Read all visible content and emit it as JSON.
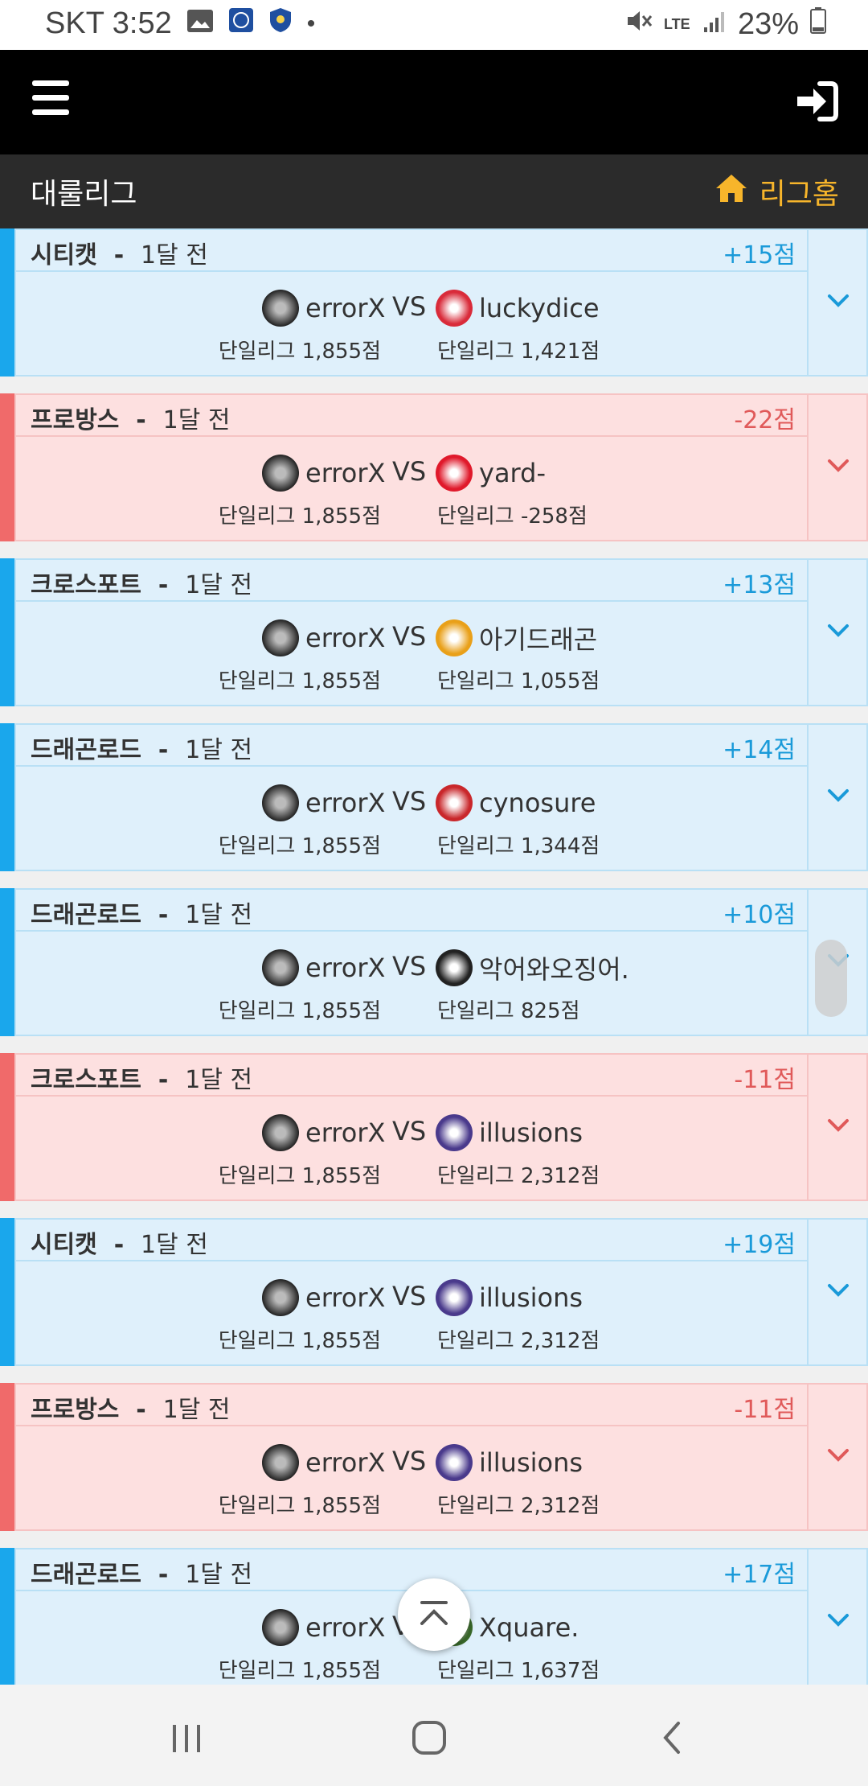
{
  "status": {
    "carrier_time": "SKT 3:52",
    "net": "LTE",
    "battery": "23%"
  },
  "header": {
    "section_title": "대룰리그",
    "home_label": "리그홈"
  },
  "player": {
    "name": "errorX",
    "rating": "단일리그 1,855점"
  },
  "vs_label": "VS",
  "matches": [
    {
      "result": "win",
      "league": "시티캣",
      "ago": "1달 전",
      "delta": "+15점",
      "opponent": "luckydice",
      "opp_rating": "단일리그 1,421점"
    },
    {
      "result": "loss",
      "league": "프로방스",
      "ago": "1달 전",
      "delta": "-22점",
      "opponent": "yard-",
      "opp_rating": "단일리그 -258점"
    },
    {
      "result": "win",
      "league": "크로스포트",
      "ago": "1달 전",
      "delta": "+13점",
      "opponent": "아기드래곤",
      "opp_rating": "단일리그 1,055점"
    },
    {
      "result": "win",
      "league": "드래곤로드",
      "ago": "1달 전",
      "delta": "+14점",
      "opponent": "cynosure",
      "opp_rating": "단일리그 1,344점"
    },
    {
      "result": "win",
      "league": "드래곤로드",
      "ago": "1달 전",
      "delta": "+10점",
      "opponent": "악어와오징어.",
      "opp_rating": "단일리그 825점"
    },
    {
      "result": "loss",
      "league": "크로스포트",
      "ago": "1달 전",
      "delta": "-11점",
      "opponent": "illusions",
      "opp_rating": "단일리그 2,312점"
    },
    {
      "result": "win",
      "league": "시티캣",
      "ago": "1달 전",
      "delta": "+19점",
      "opponent": "illusions",
      "opp_rating": "단일리그 2,312점"
    },
    {
      "result": "loss",
      "league": "프로방스",
      "ago": "1달 전",
      "delta": "-11점",
      "opponent": "illusions",
      "opp_rating": "단일리그 2,312점"
    },
    {
      "result": "win",
      "league": "드래곤로드",
      "ago": "1달 전",
      "delta": "+17점",
      "opponent": "Xquare.",
      "opp_rating": "단일리그 1,637점"
    }
  ],
  "colors": {
    "win_stripe": "#1aa7ec",
    "loss_stripe": "#f06a6a",
    "home_accent": "#f7b52b"
  }
}
